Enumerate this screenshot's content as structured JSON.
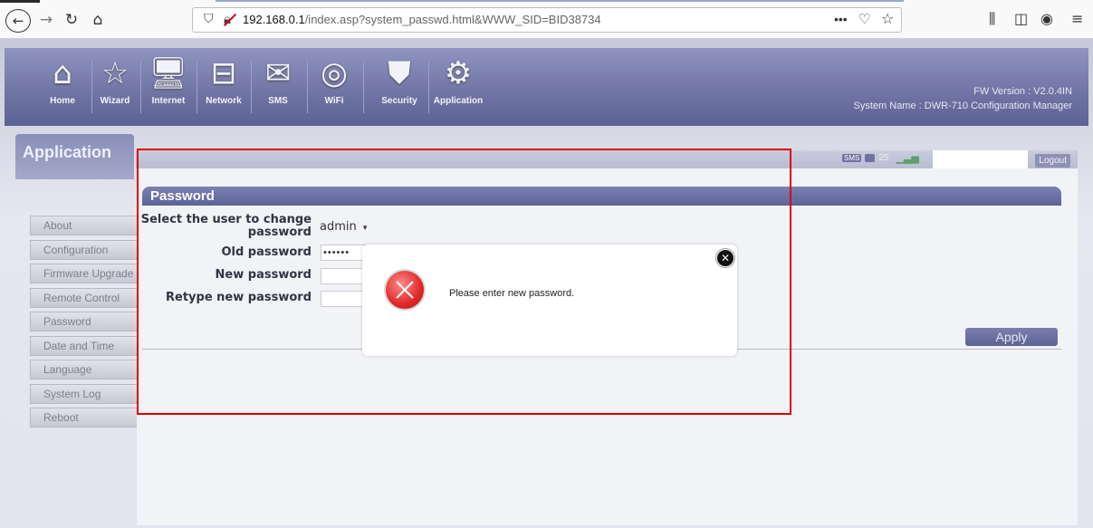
{
  "browser": {
    "url_host": "192.168.0.1",
    "url_path": "/index.asp?system_passwd.html&WWW_SID=BID38734"
  },
  "router": {
    "menu": [
      {
        "label": "Home",
        "icon": "home-icon"
      },
      {
        "label": "Wizard",
        "icon": "wizard-icon"
      },
      {
        "label": "Internet",
        "icon": "internet-icon"
      },
      {
        "label": "Network",
        "icon": "network-icon"
      },
      {
        "label": "SMS",
        "icon": "sms-icon"
      },
      {
        "label": "WiFi",
        "icon": "wifi-icon"
      },
      {
        "label": "Security",
        "icon": "security-icon"
      },
      {
        "label": "Application",
        "icon": "application-icon"
      }
    ],
    "fw_version": "FW Version : V2.0.4IN",
    "system_name": "System Name : DWR-710 Configuration Manager",
    "left_tab_title": "Application",
    "status": {
      "sms": "SMS",
      "message_count": "25",
      "logout_label": "Logout"
    },
    "sidebar": [
      "About",
      "Configuration",
      "Firmware Upgrade",
      "Remote Control",
      "Password",
      "Date and Time",
      "Language",
      "System Log",
      "Reboot"
    ],
    "section_title": "Password",
    "form": {
      "select_user_label_line1": "Select the user to change",
      "select_user_label_line2": "password",
      "select_user_value": "admin",
      "old_password_label": "Old password",
      "old_password_value": "••••••",
      "new_password_label": "New password",
      "retype_password_label": "Retype new password",
      "apply_label": "Apply"
    }
  },
  "dialog": {
    "message": "Please enter new password."
  },
  "colors": {
    "banner": "#6e73a3",
    "section_header": "#5e6398",
    "highlight_outline": "#e00000",
    "error_icon": "#e02828"
  }
}
